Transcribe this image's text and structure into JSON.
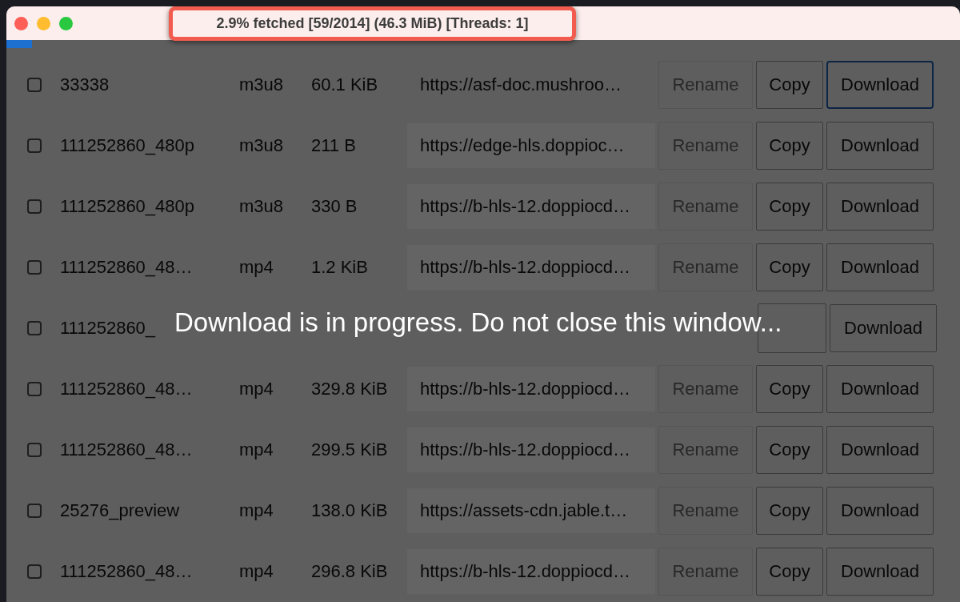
{
  "window": {
    "title": "2.9% fetched [59/2014] (46.3 MiB) [Threads: 1]",
    "title_highlighted": true
  },
  "progress": {
    "level": 0.027
  },
  "rows": [
    {
      "checked": false,
      "name": "33338",
      "type": "m3u8",
      "size": "60.1 KiB",
      "url": "https://asf-doc.mushroo…",
      "rename": "Rename",
      "rename_disabled": true,
      "copy": "Copy",
      "download": "Download",
      "download_focused": true
    },
    {
      "checked": false,
      "name": "111252860_480p",
      "type": "m3u8",
      "size": "211 B",
      "url": "https://edge-hls.doppioc…",
      "rename": "Rename",
      "rename_disabled": true,
      "copy": "Copy",
      "download": "Download",
      "download_focused": false
    },
    {
      "checked": false,
      "name": "111252860_480p",
      "type": "m3u8",
      "size": "330 B",
      "url": "https://b-hls-12.doppiocd…",
      "rename": "Rename",
      "rename_disabled": true,
      "copy": "Copy",
      "download": "Download",
      "download_focused": false
    },
    {
      "checked": false,
      "name": "111252860_48…",
      "type": "mp4",
      "size": "1.2 KiB",
      "url": "https://b-hls-12.doppiocd…",
      "rename": "Rename",
      "rename_disabled": true,
      "copy": "Copy",
      "download": "Download",
      "download_focused": false
    },
    {
      "checked": false,
      "name": "111252860_",
      "download": "Download",
      "download_focused": false
    },
    {
      "checked": false,
      "name": "111252860_48…",
      "type": "mp4",
      "size": "329.8 KiB",
      "url": "https://b-hls-12.doppiocd…",
      "rename": "Rename",
      "rename_disabled": true,
      "copy": "Copy",
      "download": "Download",
      "download_focused": false
    },
    {
      "checked": false,
      "name": "111252860_48…",
      "type": "mp4",
      "size": "299.5 KiB",
      "url": "https://b-hls-12.doppiocd…",
      "rename": "Rename",
      "rename_disabled": true,
      "copy": "Copy",
      "download": "Download",
      "download_focused": false
    },
    {
      "checked": false,
      "name": "25276_preview",
      "type": "mp4",
      "size": "138.0 KiB",
      "url": "https://assets-cdn.jable.t…",
      "rename": "Rename",
      "rename_disabled": true,
      "copy": "Copy",
      "download": "Download",
      "download_focused": false
    },
    {
      "checked": false,
      "name": "111252860_48…",
      "type": "mp4",
      "size": "296.8 KiB",
      "url": "https://b-hls-12.doppiocd…",
      "rename": "Rename",
      "rename_disabled": true,
      "copy": "Copy",
      "download": "Download",
      "download_focused": false
    }
  ],
  "overlay": {
    "message": "Download is in progress. Do not close this window..."
  }
}
